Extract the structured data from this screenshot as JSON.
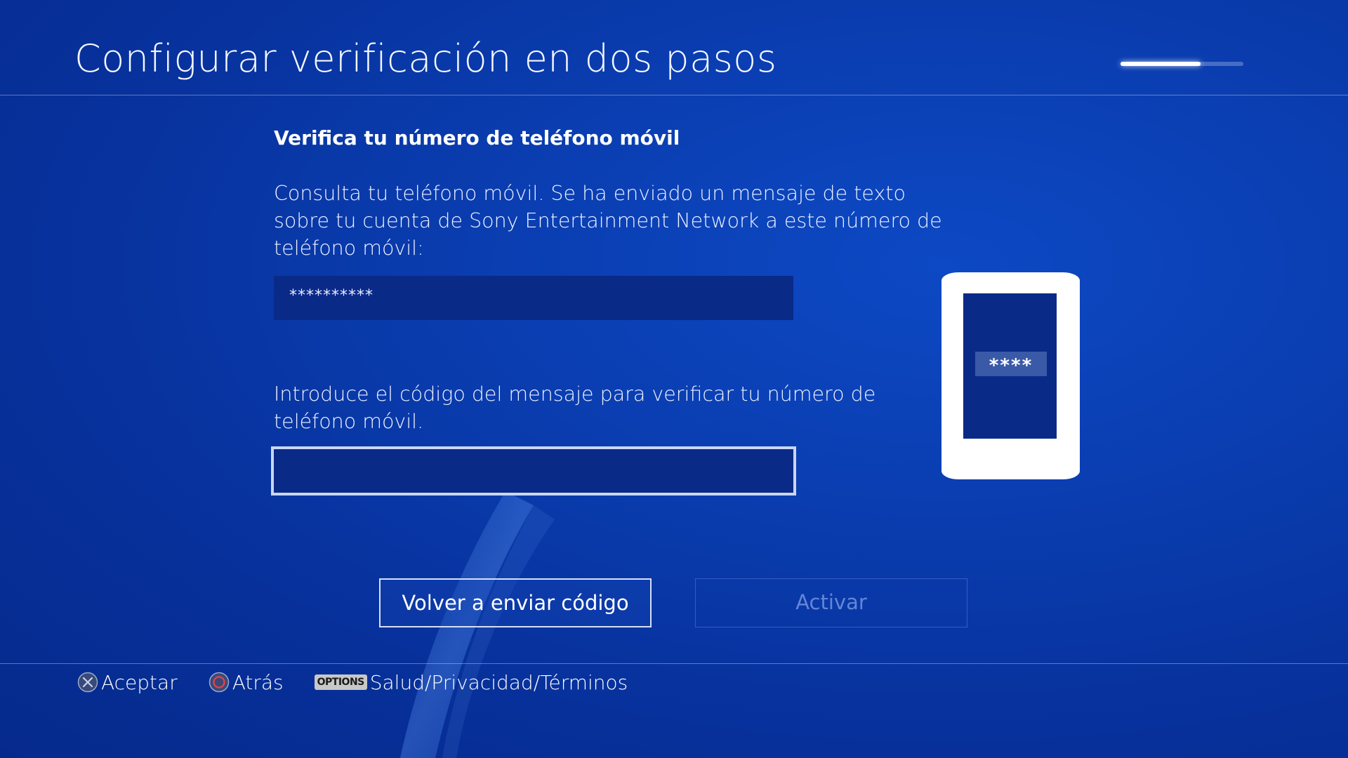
{
  "header": {
    "title": "Configurar verificación en dos pasos",
    "progress": 0.65
  },
  "main": {
    "heading": "Verifica tu número de teléfono móvil",
    "instructions": "Consulta tu teléfono móvil. Se ha enviado un mensaje de texto sobre tu cuenta de Sony Entertainment Network a este número de teléfono móvil:",
    "phone_number_masked": "**********",
    "code_prompt": "Introduce el código del mensaje para verificar tu número de teléfono móvil.",
    "code_value": "",
    "phone_illustration_code": "****"
  },
  "buttons": {
    "resend": "Volver a enviar código",
    "activate": "Activar"
  },
  "footer": {
    "accept": "Aceptar",
    "back": "Atrás",
    "options_badge": "OPTIONS",
    "options_label": "Salud/Privacidad/Términos"
  },
  "colors": {
    "background": "#0a3db0",
    "field": "#0a2a88",
    "focus_border": "#c9d6f4",
    "circle_button": "#e0414b"
  },
  "icons": {
    "accept": "cross-button-icon",
    "back": "circle-button-icon",
    "options": "options-button-icon"
  }
}
